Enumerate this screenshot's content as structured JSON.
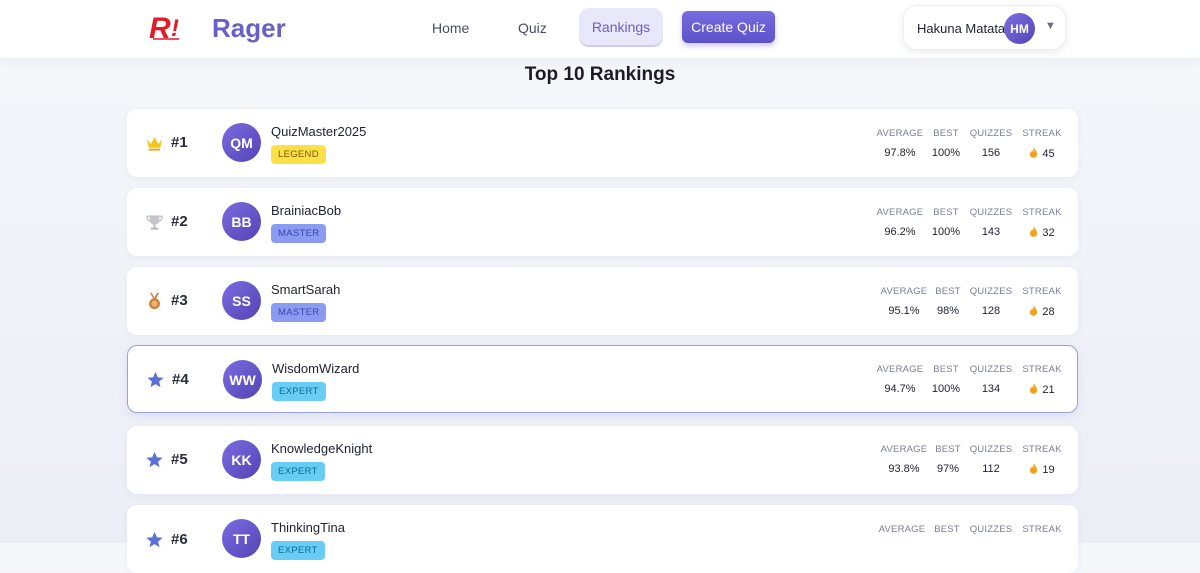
{
  "app": {
    "name": "Rager"
  },
  "nav": {
    "home": "Home",
    "quiz": "Quiz",
    "rankings": "Rankings",
    "create": "Create Quiz"
  },
  "user": {
    "name": "Hakuna Matata",
    "initials": "HM"
  },
  "page": {
    "title": "Top 10 Rankings"
  },
  "stat_labels": {
    "average": "AVERAGE",
    "best": "BEST",
    "quizzes": "QUIZZES",
    "streak": "STREAK"
  },
  "rankings": [
    {
      "rank": "#1",
      "icon": "crown-icon",
      "initials": "QM",
      "name": "QuizMaster2025",
      "badge": "LEGEND",
      "average": "97.8%",
      "best": "100%",
      "quizzes": "156",
      "streak": "45"
    },
    {
      "rank": "#2",
      "icon": "trophy-icon",
      "initials": "BB",
      "name": "BrainiacBob",
      "badge": "MASTER",
      "average": "96.2%",
      "best": "100%",
      "quizzes": "143",
      "streak": "32"
    },
    {
      "rank": "#3",
      "icon": "medal-icon",
      "initials": "SS",
      "name": "SmartSarah",
      "badge": "MASTER",
      "average": "95.1%",
      "best": "98%",
      "quizzes": "128",
      "streak": "28"
    },
    {
      "rank": "#4",
      "icon": "star-icon",
      "initials": "WW",
      "name": "WisdomWizard",
      "badge": "EXPERT",
      "average": "94.7%",
      "best": "100%",
      "quizzes": "134",
      "streak": "21"
    },
    {
      "rank": "#5",
      "icon": "star-icon",
      "initials": "KK",
      "name": "KnowledgeKnight",
      "badge": "EXPERT",
      "average": "93.8%",
      "best": "97%",
      "quizzes": "112",
      "streak": "19"
    },
    {
      "rank": "#6",
      "icon": "star-icon",
      "initials": "TT",
      "name": "ThinkingTina",
      "badge": "EXPERT"
    }
  ],
  "colors": {
    "brand": "#6a5fc4",
    "legend_badge": "#fde047",
    "master_badge": "#8b9af2",
    "expert_badge": "#67cdf5",
    "star": "#5b6fd6"
  }
}
